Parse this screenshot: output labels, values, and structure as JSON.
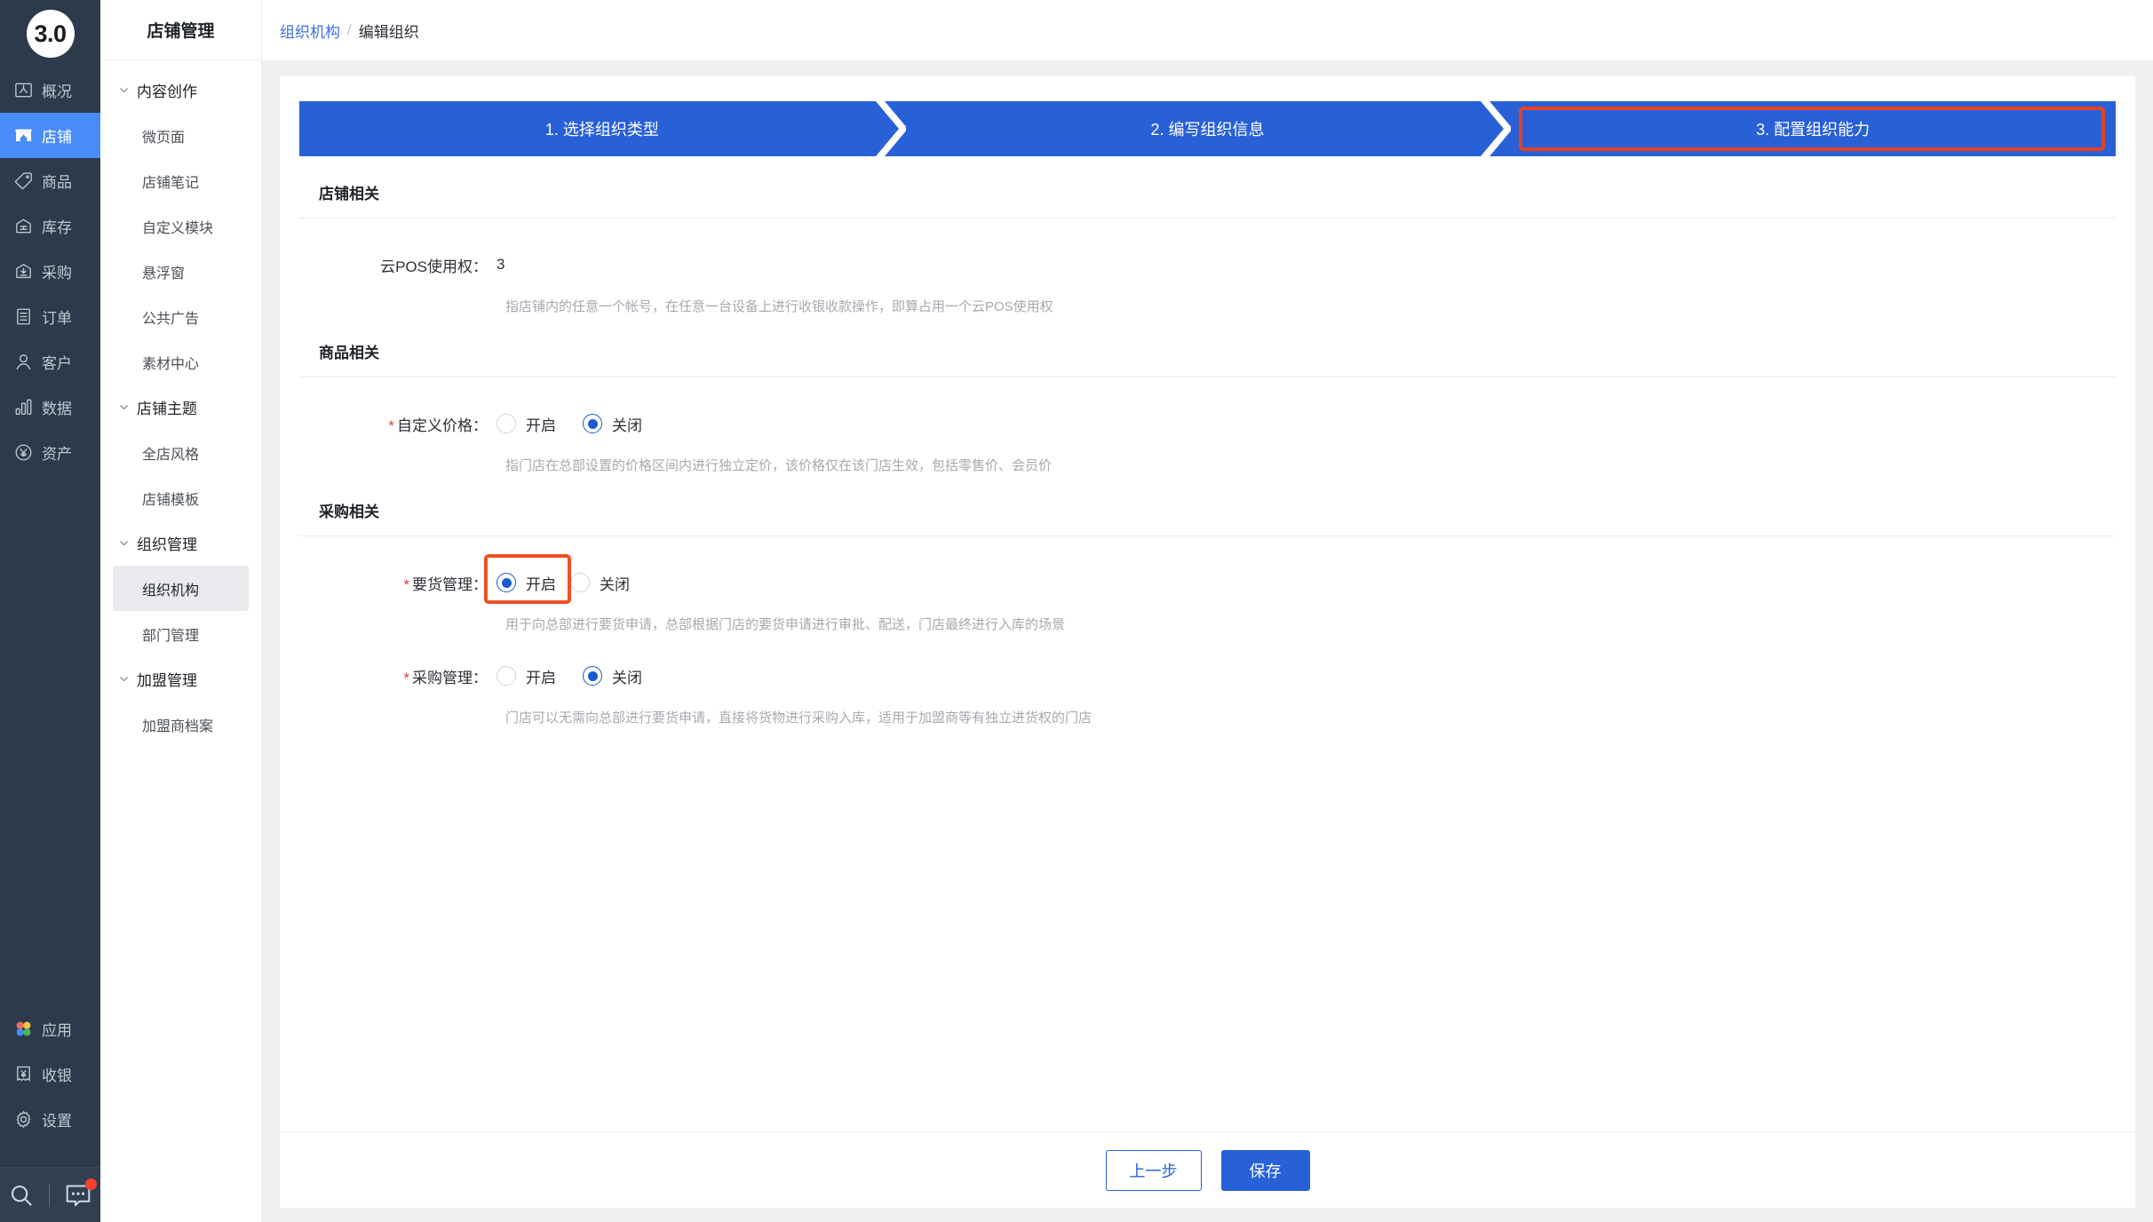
{
  "rail": {
    "logo": "3.0",
    "items": [
      {
        "label": "概况",
        "icon": "dashboard-icon",
        "active": false
      },
      {
        "label": "店铺",
        "icon": "shop-icon",
        "active": true
      },
      {
        "label": "商品",
        "icon": "tag-icon",
        "active": false
      },
      {
        "label": "库存",
        "icon": "warehouse-icon",
        "active": false
      },
      {
        "label": "采购",
        "icon": "purchase-icon",
        "active": false
      },
      {
        "label": "订单",
        "icon": "order-icon",
        "active": false
      },
      {
        "label": "客户",
        "icon": "user-icon",
        "active": false
      },
      {
        "label": "数据",
        "icon": "chart-icon",
        "active": false
      },
      {
        "label": "资产",
        "icon": "yuan-circle-icon",
        "active": false
      }
    ],
    "bottom_items": [
      {
        "label": "应用",
        "icon": "apps-icon",
        "active": false
      },
      {
        "label": "收银",
        "icon": "cashier-icon",
        "active": false
      },
      {
        "label": "设置",
        "icon": "gear-icon",
        "active": false
      }
    ],
    "footer_icons": [
      {
        "name": "search-icon"
      },
      {
        "name": "message-icon",
        "badge": true
      }
    ],
    "active_color": "#4a8cf7",
    "bg_color": "#2c3a4b"
  },
  "subnav": {
    "title": "店铺管理",
    "groups": [
      {
        "label": "内容创作",
        "items": [
          "微页面",
          "店铺笔记",
          "自定义模块",
          "悬浮窗",
          "公共广告",
          "素材中心"
        ]
      },
      {
        "label": "店铺主题",
        "items": [
          "全店风格",
          "店铺模板"
        ]
      },
      {
        "label": "组织管理",
        "items": [
          "组织机构",
          "部门管理"
        ]
      },
      {
        "label": "加盟管理",
        "items": [
          "加盟商档案"
        ]
      }
    ],
    "active_item": "组织机构"
  },
  "breadcrumb": {
    "parent": "组织机构",
    "separator": "/",
    "current": "编辑组织"
  },
  "stepper": {
    "steps": [
      {
        "label": "1. 选择组织类型",
        "highlighted": false
      },
      {
        "label": "2. 编写组织信息",
        "highlighted": false
      },
      {
        "label": "3. 配置组织能力",
        "highlighted": true
      }
    ],
    "bg_color": "#2860d8",
    "highlight_color": "#e8401f"
  },
  "form": {
    "sections": [
      {
        "title": "店铺相关",
        "fields": [
          {
            "label": "云POS使用权：",
            "required": false,
            "type": "text",
            "value": "3",
            "hint": "指店铺内的任意一个帐号，在任意一台设备上进行收银收款操作，即算占用一个云POS使用权"
          }
        ]
      },
      {
        "title": "商品相关",
        "fields": [
          {
            "label": "自定义价格：",
            "required": true,
            "type": "radio",
            "options": [
              {
                "label": "开启",
                "selected": false,
                "highlighted": false
              },
              {
                "label": "关闭",
                "selected": true,
                "highlighted": false
              }
            ],
            "hint": "指门店在总部设置的价格区间内进行独立定价，该价格仅在该门店生效，包括零售价、会员价"
          }
        ]
      },
      {
        "title": "采购相关",
        "fields": [
          {
            "label": "要货管理：",
            "required": true,
            "type": "radio",
            "options": [
              {
                "label": "开启",
                "selected": true,
                "highlighted": true
              },
              {
                "label": "关闭",
                "selected": false,
                "highlighted": false
              }
            ],
            "hint": "用于向总部进行要货申请，总部根据门店的要货申请进行审批、配送，门店最终进行入库的场景"
          },
          {
            "label": "采购管理：",
            "required": true,
            "type": "radio",
            "options": [
              {
                "label": "开启",
                "selected": false,
                "highlighted": false
              },
              {
                "label": "关闭",
                "selected": true,
                "highlighted": false
              }
            ],
            "hint": "门店可以无需向总部进行要货申请，直接将货物进行采购入库，适用于加盟商等有独立进货权的门店"
          }
        ]
      }
    ]
  },
  "footer": {
    "prev_label": "上一步",
    "save_label": "保存"
  }
}
